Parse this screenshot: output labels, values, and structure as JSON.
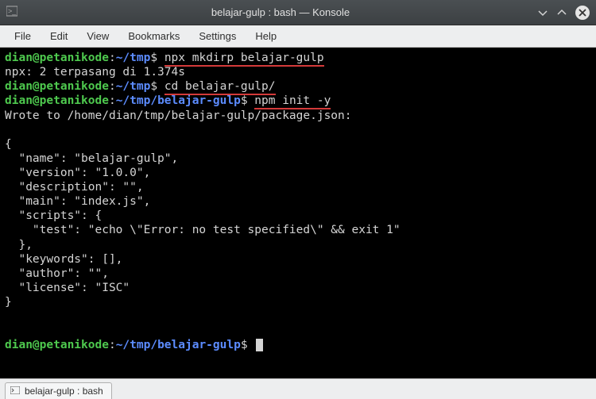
{
  "window": {
    "title": "belajar-gulp : bash — Konsole"
  },
  "menu": {
    "file": "File",
    "edit": "Edit",
    "view": "View",
    "bookmarks": "Bookmarks",
    "settings": "Settings",
    "help": "Help"
  },
  "terminal": {
    "line1": {
      "user": "dian@petanikode",
      "colon": ":",
      "path": "~/tmp",
      "dollar": "$ ",
      "cmd": "npx mkdirp belajar-gulp"
    },
    "line2": "npx: 2 terpasang di 1.374s",
    "line3": {
      "user": "dian@petanikode",
      "colon": ":",
      "path": "~/tmp",
      "dollar": "$ ",
      "cmd": "cd belajar-gulp/"
    },
    "line4": {
      "user": "dian@petanikode",
      "colon": ":",
      "path": "~/tmp/belajar-gulp",
      "dollar": "$ ",
      "cmd": "npm init -y"
    },
    "line5": "Wrote to /home/dian/tmp/belajar-gulp/package.json:",
    "json1": "{",
    "json2": "  \"name\": \"belajar-gulp\",",
    "json3": "  \"version\": \"1.0.0\",",
    "json4": "  \"description\": \"\",",
    "json5": "  \"main\": \"index.js\",",
    "json6": "  \"scripts\": {",
    "json7": "    \"test\": \"echo \\\"Error: no test specified\\\" && exit 1\"",
    "json8": "  },",
    "json9": "  \"keywords\": [],",
    "json10": "  \"author\": \"\",",
    "json11": "  \"license\": \"ISC\"",
    "json12": "}",
    "promptEnd": {
      "user": "dian@petanikode",
      "colon": ":",
      "path": "~/tmp/belajar-gulp",
      "dollar": "$ "
    }
  },
  "tab": {
    "label": "belajar-gulp : bash"
  }
}
